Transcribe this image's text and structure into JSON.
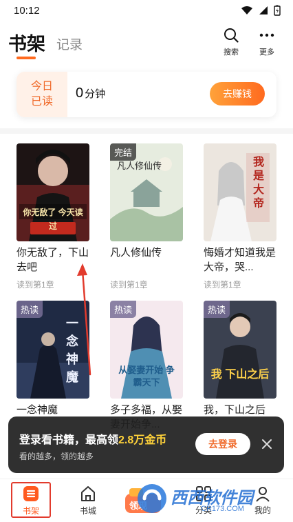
{
  "status_bar": {
    "time": "10:12"
  },
  "header": {
    "tab_shelf": "书架",
    "tab_record": "记录",
    "search_label": "搜索",
    "more_label": "更多"
  },
  "reading_card": {
    "label_line1": "今日",
    "label_line2": "已读",
    "value": "0",
    "unit": "分钟",
    "earn_button": "去赚钱"
  },
  "books": [
    {
      "title": "你无敌了，下山去吧",
      "progress": "读到第1章",
      "badge": "",
      "cover_text": "你无敌了 今天读过",
      "cover_color": "#2a1a1a"
    },
    {
      "title": "凡人修仙传",
      "progress": "读到第1章",
      "badge": "完结",
      "cover_text": "凡人修仙传",
      "cover_color": "#dfe8d8"
    },
    {
      "title": "悔婚才知道我是大帝，哭...",
      "progress": "读到第1章",
      "badge": "",
      "cover_text": "我是大帝",
      "cover_color": "#e9e2dc"
    },
    {
      "title": "一念神魔",
      "progress": "",
      "badge": "热读",
      "cover_text": "一念神魔",
      "cover_color": "#2b3652"
    },
    {
      "title": "多子多福，从娶妻开始争...",
      "progress": "",
      "badge": "热读",
      "cover_text": "从娶妻开始 争霸天下",
      "cover_color": "#f3e6ea"
    },
    {
      "title": "我，下山之后",
      "progress": "",
      "badge": "热读",
      "cover_text": "我 下山之后",
      "cover_color": "#3a3f4a"
    }
  ],
  "login_banner": {
    "title_prefix": "登录看书籍，最高领",
    "title_highlight": "2.8万金币",
    "subtitle": "看的越多，领的越多",
    "login_button": "去登录"
  },
  "bottom_nav": {
    "shelf": "书架",
    "store": "书城",
    "welfare_badge": "领现",
    "category": "分类",
    "me": "我的"
  },
  "watermark": {
    "brand": "西西软件园",
    "domain": "CR173.COM"
  },
  "colors": {
    "accent": "#ff6a1f",
    "highlight": "#ffd23a",
    "annotation": "#e23b2d"
  }
}
